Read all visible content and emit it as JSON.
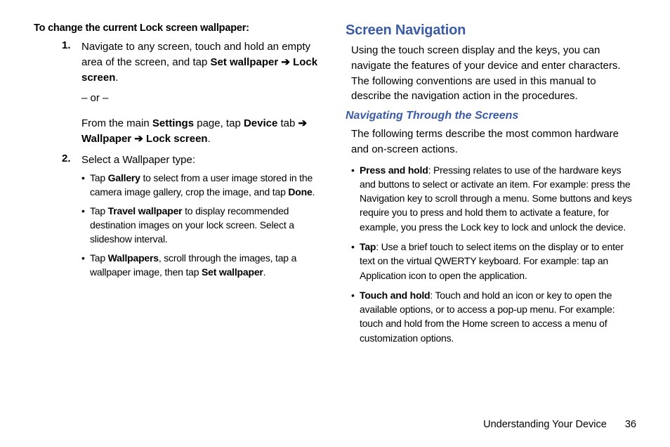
{
  "left": {
    "heading": "To change the current Lock screen wallpaper:",
    "step1_num": "1.",
    "step1_a": "Navigate to any screen, touch and hold an empty area of the screen, and tap ",
    "step1_b1": "Set wallpaper",
    "step1_arrow1": " ➔ ",
    "step1_b2": "Lock screen",
    "step1_end": ".",
    "or": "– or –",
    "step1c_a": "From the main ",
    "step1c_b1": "Settings",
    "step1c_m": " page, tap ",
    "step1c_b2": "Device",
    "step1c_m2": " tab ",
    "step1c_arrow": "➔",
    "step1c_b3": "Wallpaper",
    "step1c_arrow2": " ➔ ",
    "step1c_b4": "Lock screen",
    "step1c_end": ".",
    "step2_num": "2.",
    "step2_text": "Select a Wallpaper type:",
    "sub1_a": "Tap ",
    "sub1_b": "Gallery",
    "sub1_c": " to select from a user image stored in the camera image gallery, crop the image, and tap ",
    "sub1_d": "Done",
    "sub1_e": ".",
    "sub2_a": "Tap ",
    "sub2_b": "Travel wallpaper",
    "sub2_c": " to display recommended destination images on your lock screen. Select a slideshow interval.",
    "sub3_a": "Tap ",
    "sub3_b": "Wallpapers",
    "sub3_c": ", scroll through the images, tap a wallpaper image, then tap ",
    "sub3_d": "Set wallpaper",
    "sub3_e": "."
  },
  "right": {
    "h1": "Screen Navigation",
    "p1": "Using the touch screen display and the keys, you can navigate the features of your device and enter characters. The following conventions are used in this manual to describe the navigation action in the procedures.",
    "h2": "Navigating Through the Screens",
    "p2": "The following terms describe the most common hardware and on-screen actions.",
    "b1_t": "Press and hold",
    "b1_r": ": Pressing relates to use of the hardware keys and buttons to select or activate an item. For example: press the Navigation key to scroll through a menu. Some buttons and keys require you to press and hold them to activate a feature, for example, you press the Lock key to lock and unlock the device.",
    "b2_t": "Tap",
    "b2_r": ": Use a brief touch to select items on the display or to enter text on the virtual QWERTY keyboard. For example: tap an Application icon to open the application.",
    "b3_t": "Touch and hold",
    "b3_r": ": Touch and hold an icon or key to open the available options, or to access a pop-up menu. For example: touch and hold from the Home screen to access a menu of customization options."
  },
  "footer": {
    "section": "Understanding Your Device",
    "page": "36"
  }
}
